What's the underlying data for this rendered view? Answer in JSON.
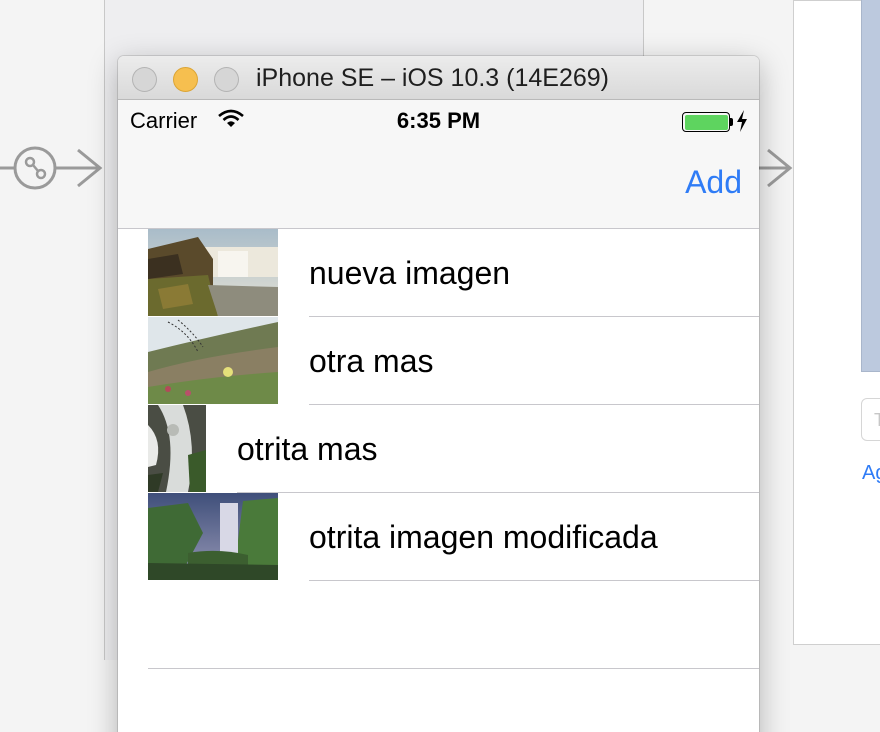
{
  "window": {
    "title": "iPhone SE – iOS 10.3 (14E269)"
  },
  "status_bar": {
    "carrier": "Carrier",
    "time": "6:35 PM",
    "battery_color": "#5ed45f"
  },
  "nav_bar": {
    "add_label": "Add",
    "tint_color": "#2f7cf6"
  },
  "table": {
    "rows": [
      {
        "label": "nueva imagen",
        "thumbnail": "waterfall-landscape-photo"
      },
      {
        "label": "otra mas",
        "thumbnail": "hillside-flowers-photo"
      },
      {
        "label": "otrita mas",
        "thumbnail": "waterfall-closeup-photo"
      },
      {
        "label": "otrita imagen modificada",
        "thumbnail": "waterfall-valley-photo"
      }
    ]
  },
  "ib_background": {
    "partial_field_text": "T",
    "partial_link_text": "Ag"
  }
}
